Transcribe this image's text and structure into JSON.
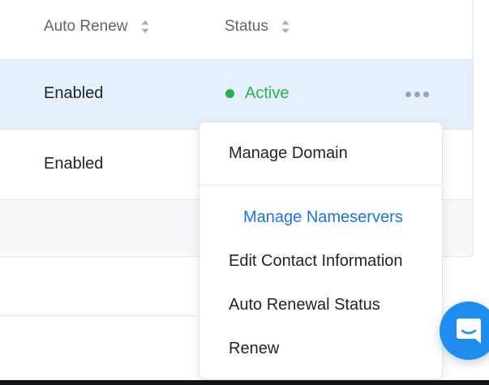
{
  "table": {
    "columns": [
      {
        "label": "Auto Renew"
      },
      {
        "label": "Status"
      }
    ],
    "rows": [
      {
        "auto_renew": "Enabled",
        "status": "Active",
        "selected": true
      },
      {
        "auto_renew": "Enabled",
        "status": ""
      }
    ]
  },
  "menu": {
    "items": [
      {
        "label": "Manage Domain"
      },
      {
        "label": "Manage Nameservers"
      },
      {
        "label": "Edit Contact Information"
      },
      {
        "label": "Auto Renewal Status"
      },
      {
        "label": "Renew"
      }
    ]
  },
  "icons": {
    "sort": "sort-icon",
    "more": "more-horizontal-icon",
    "chat": "chat-bubble-icon"
  },
  "colors": {
    "status_active": "#27b24a",
    "selected_row": "#e6f0fd",
    "link": "#1a73e8",
    "chat_button": "#1f8ded"
  }
}
